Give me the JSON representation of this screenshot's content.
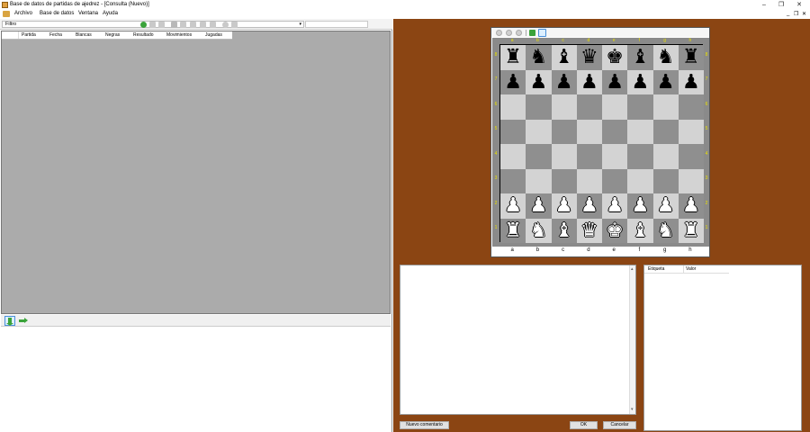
{
  "window": {
    "title": "Base de datos de partidas de ajedrez - [Consulta (Nuevo)]",
    "controls": [
      "–",
      "❐",
      "✕"
    ]
  },
  "menubar": {
    "items": [
      "Archivo",
      "Base de datos",
      "Ventana",
      "Ayuda"
    ],
    "mdi_controls": [
      "_",
      "❐",
      "✕"
    ]
  },
  "toolbar": {
    "filter_label": "Filtro",
    "filter_arrow": "▾",
    "search_value": ""
  },
  "grid": {
    "columns": [
      "Partida",
      "Fecha",
      "Blancas",
      "Negras",
      "Resultado",
      "Movimientos",
      "Jugadas"
    ]
  },
  "board": {
    "files": [
      "a",
      "b",
      "c",
      "d",
      "e",
      "f",
      "g",
      "h"
    ],
    "ranks": [
      "8",
      "7",
      "6",
      "5",
      "4",
      "3",
      "2",
      "1"
    ],
    "position": [
      [
        "r",
        "n",
        "b",
        "q",
        "k",
        "b",
        "n",
        "r"
      ],
      [
        "p",
        "p",
        "p",
        "p",
        "p",
        "p",
        "p",
        "p"
      ],
      [
        "",
        "",
        "",
        "",
        "",
        "",
        "",
        ""
      ],
      [
        "",
        "",
        "",
        "",
        "",
        "",
        "",
        ""
      ],
      [
        "",
        "",
        "",
        "",
        "",
        "",
        "",
        ""
      ],
      [
        "",
        "",
        "",
        "",
        "",
        "",
        "",
        ""
      ],
      [
        "P",
        "P",
        "P",
        "P",
        "P",
        "P",
        "P",
        "P"
      ],
      [
        "R",
        "N",
        "B",
        "Q",
        "K",
        "B",
        "N",
        "R"
      ]
    ],
    "light_color": "#d3d3d3",
    "dark_color": "#8f8f8f",
    "coord_color": "#e8e000"
  },
  "tags": {
    "headers": [
      "Etiqueta",
      "Valor"
    ]
  },
  "buttons": {
    "new_comment": "Nuevo comentario",
    "ok": "OK",
    "cancel": "Cancelar"
  },
  "colors": {
    "background_brown": "#8b4513",
    "grid_gray": "#ababab"
  }
}
